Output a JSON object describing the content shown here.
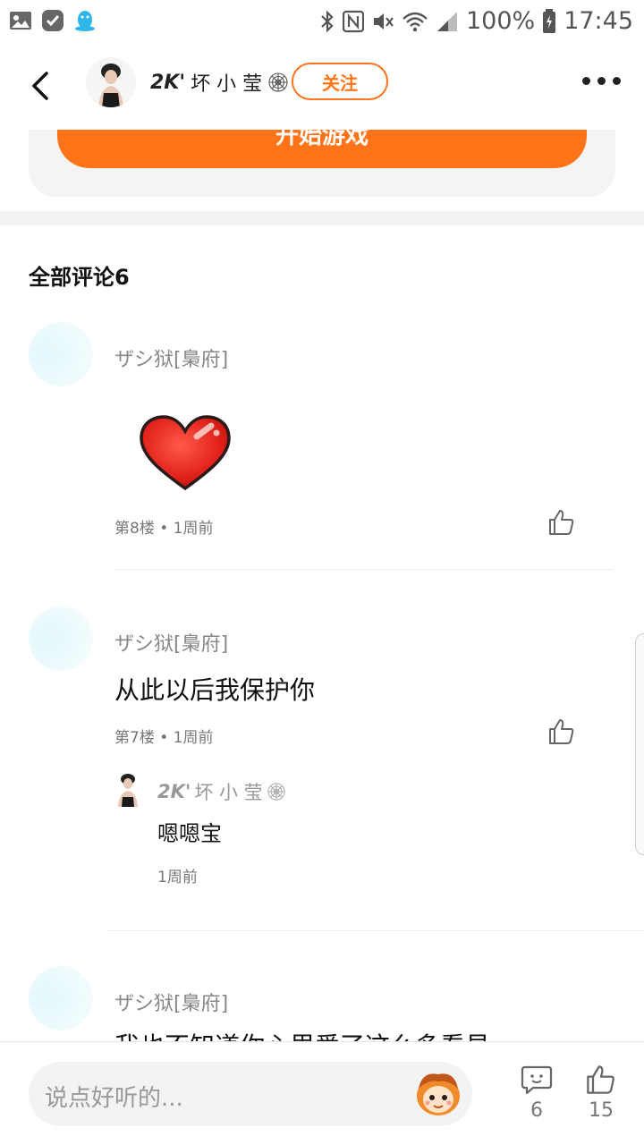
{
  "status_bar": {
    "battery": "100%",
    "time": "17:45"
  },
  "header": {
    "user_brand": "2K'",
    "user_name": "坏 小 莹",
    "follow_label": "关注"
  },
  "game_card": {
    "start_label": "开始游戏"
  },
  "comments": {
    "title": "全部评论6",
    "items": [
      {
        "author": "ザシ狱[梟府]",
        "meta": "第8楼 • 1周前",
        "content": "heart-sticker"
      },
      {
        "author": "ザシ狱[梟府]",
        "text": "从此以后我保护你",
        "meta": "第7楼 • 1周前",
        "reply": {
          "author_brand": "2K'",
          "author_name": "坏 小 莹",
          "text": "嗯嗯宝",
          "time": "1周前"
        }
      },
      {
        "author": "ザシ狱[梟府]",
        "text": "我也不知道你心里爱了这么多看見"
      }
    ]
  },
  "bottom_bar": {
    "input_placeholder": "说点好听的...",
    "comment_count": "6",
    "like_count": "15"
  },
  "colors": {
    "accent": "#ff7418",
    "muted": "#888888"
  }
}
